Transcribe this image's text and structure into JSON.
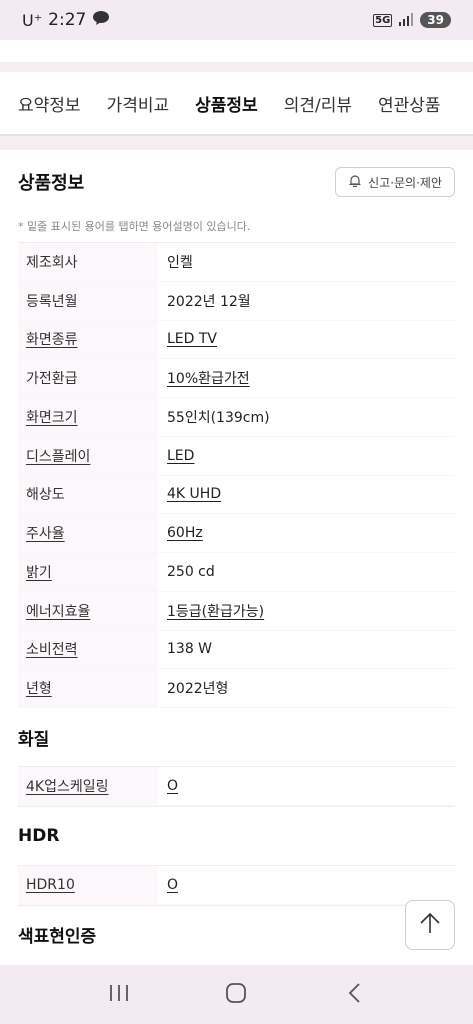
{
  "status_bar": {
    "carrier": "U⁺",
    "time": "2:27",
    "network": "5G",
    "battery": "39"
  },
  "tabs": [
    {
      "label": "요약정보"
    },
    {
      "label": "가격비교"
    },
    {
      "label": "상품정보"
    },
    {
      "label": "의견/리뷰"
    },
    {
      "label": "연관상품"
    }
  ],
  "product_info": {
    "title": "상품정보",
    "report_button": "신고·문의·제안",
    "note": "* 밑줄 표시된 용어를 탭하면 용어설명이 있습니다.",
    "rows": [
      {
        "key": "제조회사",
        "value": "인켈"
      },
      {
        "key": "등록년월",
        "value": "2022년 12월"
      },
      {
        "key": "화면종류",
        "value": "LED TV"
      },
      {
        "key": "가전환급",
        "value": "10%환급가전"
      },
      {
        "key": "화면크기",
        "value": "55인치(139cm)"
      },
      {
        "key": "디스플레이",
        "value": "LED"
      },
      {
        "key": "해상도",
        "value": "4K UHD"
      },
      {
        "key": "주사율",
        "value": "60Hz"
      },
      {
        "key": "밝기",
        "value": "250 cd"
      },
      {
        "key": "에너지효율",
        "value": "1등급(환급가능)"
      },
      {
        "key": "소비전력",
        "value": "138 W"
      },
      {
        "key": "년형",
        "value": "2022년형"
      }
    ]
  },
  "quality": {
    "title": "화질",
    "row": {
      "key": "4K업스케일링",
      "value": "O"
    }
  },
  "hdr": {
    "title": "HDR",
    "row": {
      "key": "HDR10",
      "value": "O"
    }
  },
  "color_cert": {
    "title": "색표현인증"
  },
  "colors": {
    "accent": "#111111",
    "key_bg": "#fcf7fb",
    "system_bar": "#f4eaf2"
  }
}
